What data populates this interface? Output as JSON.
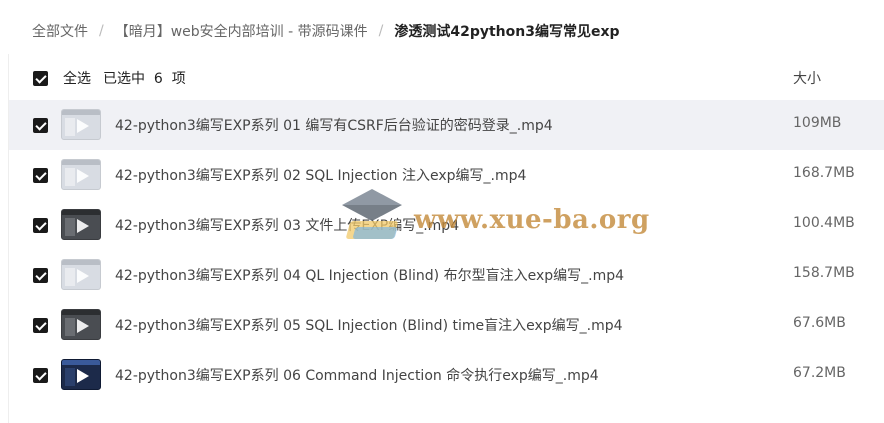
{
  "breadcrumb": {
    "items": [
      {
        "label": "全部文件"
      },
      {
        "label": "【暗月】web安全内部培训 - 带源码课件"
      },
      {
        "label": "渗透测试42python3编写常见exp"
      }
    ],
    "separator": "/"
  },
  "list_header": {
    "select_all_label": "全选",
    "selected_count_label": "已选中  6  项",
    "size_column_label": "大小"
  },
  "files": [
    {
      "name": "42-python3编写EXP系列 01 编写有CSRF后台验证的密码登录_.mp4",
      "size": "109MB",
      "checked": true
    },
    {
      "name": "42-python3编写EXP系列 02 SQL Injection 注入exp编写_.mp4",
      "size": "168.7MB",
      "checked": true
    },
    {
      "name": "42-python3编写EXP系列 03 文件上传EXP编写_.mp4",
      "size": "100.4MB",
      "checked": true
    },
    {
      "name": "42-python3编写EXP系列 04 QL Injection (Blind) 布尔型盲注入exp编写_.mp4",
      "size": "158.7MB",
      "checked": true
    },
    {
      "name": "42-python3编写EXP系列 05 SQL Injection (Blind) time盲注入exp编写_.mp4",
      "size": "67.6MB",
      "checked": true
    },
    {
      "name": "42-python3编写EXP系列 06 Command Injection 命令执行exp编写_.mp4",
      "size": "67.2MB",
      "checked": true
    }
  ],
  "watermark": {
    "text": "www.xue-ba.org"
  },
  "colors": {
    "checkbox": "#1a1a1a",
    "row_highlight": "#f0f1f5",
    "watermark_text": "#c48a3a"
  }
}
